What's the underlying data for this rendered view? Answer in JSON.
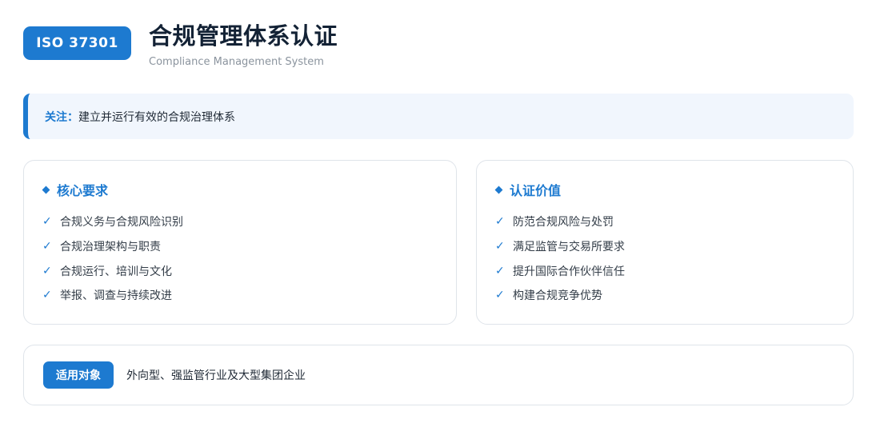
{
  "header": {
    "badge": "ISO 37301",
    "title": "合规管理体系认证",
    "subtitle": "Compliance Management System"
  },
  "notice": {
    "label": "关注：",
    "text": "建立并运行有效的合规治理体系"
  },
  "core_requirements": {
    "title": "核心要求",
    "check_icon": "✓",
    "items": [
      "合规义务与合规风险识别",
      "合规治理架构与职责",
      "合规运行、培训与文化",
      "举报、调查与持续改进"
    ]
  },
  "certification_value": {
    "title": "认证价值",
    "check_icon": "✓",
    "items": [
      "防范合规风险与处罚",
      "满足监管与交易所要求",
      "提升国际合作伙伴信任",
      "构建合规竞争优势"
    ]
  },
  "scope": {
    "label": "适用对象",
    "text": "外向型、强监管行业及大型集团企业"
  },
  "colors": {
    "accent": "#1d7ad0",
    "title": "#132235",
    "notice_bg": "#f1f6fd",
    "border": "#dfe4ea"
  }
}
